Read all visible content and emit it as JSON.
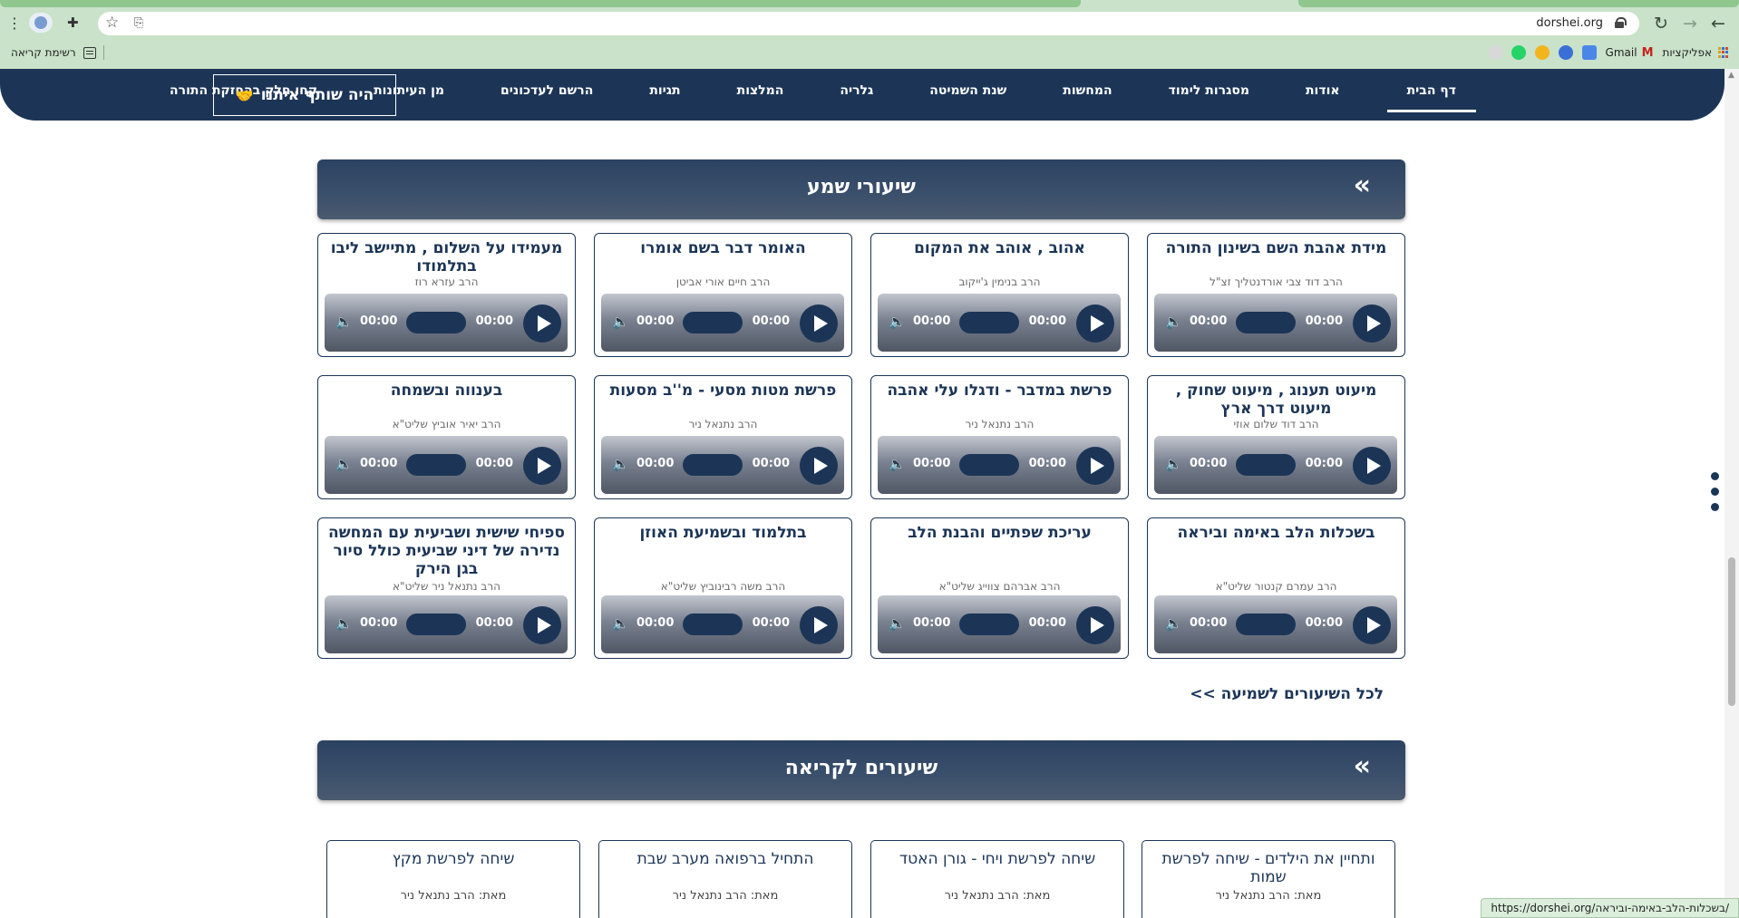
{
  "browser": {
    "url": "dorshei.org",
    "bookmarks": {
      "apps_label": "אפליקציות",
      "gmail_label": "Gmail",
      "reading_list_label": "רשימת קריאה"
    },
    "status_url": "https://dorshei.org/בשכלות-הלב-באימה-וביראה/"
  },
  "nav": {
    "items": [
      "דף הבית",
      "אודות",
      "מסגרות לימוד",
      "המחשות",
      "שנת השמיטה",
      "גלריה",
      "המלצות",
      "תגיות",
      "הרשם לעדכונים",
      "מן העיתונות",
      "קחו חלק בהחזקת התורה"
    ],
    "active_index": 0,
    "partner_button": "היה שותף איתנו"
  },
  "audio_section": {
    "title": "שיעורי שמע",
    "chevron": "«",
    "time_current": "00:00",
    "time_total": "00:00",
    "lessons": [
      {
        "title": "מידת אהבת השם בשינון התורה",
        "rabbi": "הרב דוד צבי אורדנטליך זצ\"ל"
      },
      {
        "title": "אהוב , אוהב את המקום",
        "rabbi": "הרב בנימין ג'ייקוב"
      },
      {
        "title": "האומר דבר בשם אומרו",
        "rabbi": "הרב חיים אורי אביטן"
      },
      {
        "title": "מעמידו על השלום , מתיישב ליבו בתלמודו",
        "rabbi": "הרב עזרא רוז"
      },
      {
        "title": "מיעוט תענוג , מיעוט שחוק , מיעוט דרך ארץ",
        "rabbi": "הרב דוד שלום אוזי"
      },
      {
        "title": "פרשת במדבר - ודגלו עלי אהבה",
        "rabbi": "הרב נתנאל ניר"
      },
      {
        "title": "פרשת מטות מסעי - מ''ב מסעות",
        "rabbi": "הרב נתנאל ניר"
      },
      {
        "title": "בענווה ובשמחה",
        "rabbi": "הרב יאיר אוביץ שליט\"א"
      },
      {
        "title": "בשכלות הלב באימה וביראה",
        "rabbi": "הרב עמרם קנטור שליט\"א"
      },
      {
        "title": "עריכת שפתיים והבנת הלב",
        "rabbi": "הרב אברהם צווייג שליט\"א"
      },
      {
        "title": "בתלמוד ובשמיעת האוזן",
        "rabbi": "הרב משה רבינוביץ שליט\"א"
      },
      {
        "title": "ספיחי שישית ושביעית עם המחשה נדירה של דיני שביעית כולל סיור בגן הירק",
        "rabbi": "הרב נתנאל ניר שליט\"א"
      }
    ],
    "all_link": "לכל השיעורים לשמיעה >>"
  },
  "reading_section": {
    "title": "שיעורים לקריאה",
    "chevron": "«",
    "items": [
      {
        "title": "ותחיין את הילדים - שיחה לפרשת שמות",
        "author": "מאת: הרב נתנאל ניר"
      },
      {
        "title": "שיחה לפרשת ויחי - גורן האטד",
        "author": "מאת: הרב נתנאל ניר"
      },
      {
        "title": "התחיל ברפואה מערב שבת",
        "author": "מאת: הרב נתנאל ניר"
      },
      {
        "title": "שיחה לפרשת מקץ",
        "author": "מאת: הרב נתנאל ניר"
      }
    ]
  }
}
